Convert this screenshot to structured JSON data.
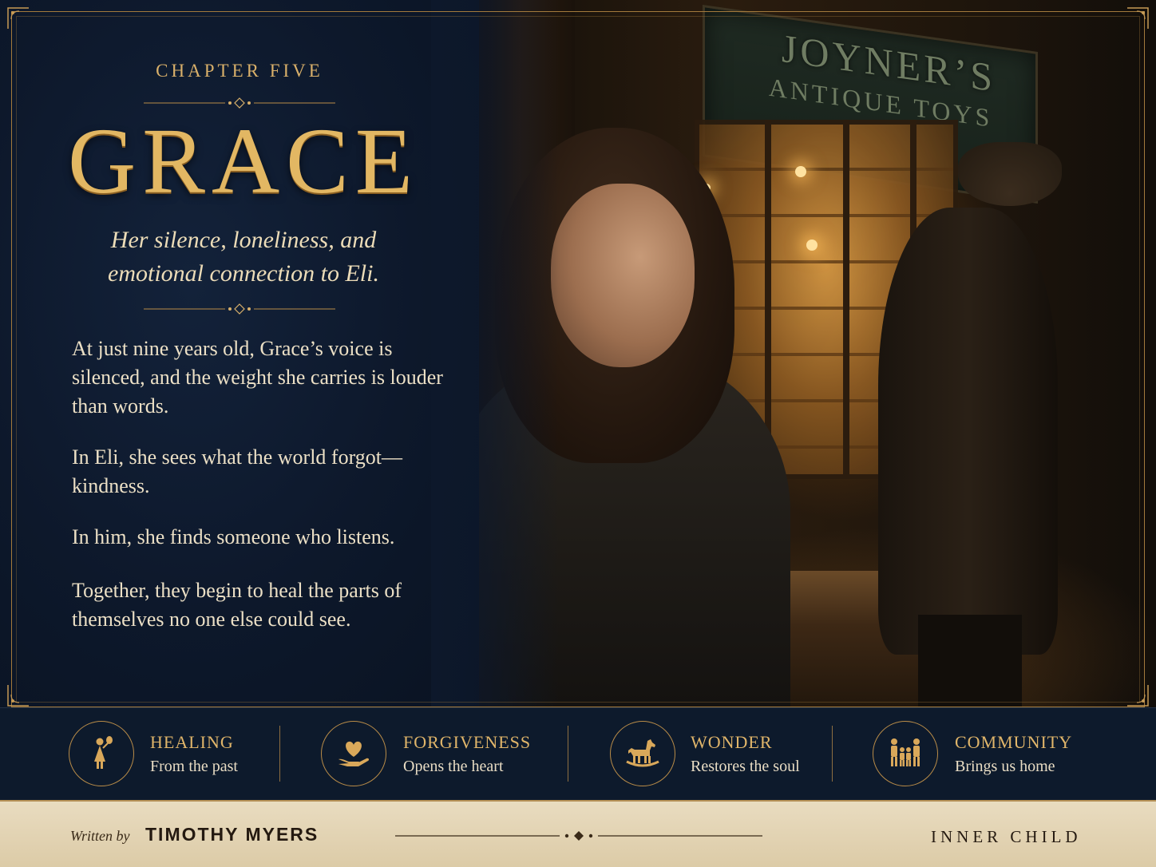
{
  "chapter": {
    "label": "CHAPTER FIVE",
    "title": "GRACE",
    "subtitle": "Her silence, loneliness, and emotional connection to Eli.",
    "paragraphs": [
      "At just nine years old, Grace’s voice is silenced, and the weight she carries is louder than words.",
      "In Eli, she sees what the world forgot—kindness.",
      "In him, she finds someone who listens.",
      "Together, they begin to heal the parts of themselves no one else could see."
    ]
  },
  "scene": {
    "sign_line1": "JOYNER’S",
    "sign_line2": "ANTIQUE TOYS"
  },
  "values": [
    {
      "title": "HEALING",
      "subtitle": "From the past",
      "icon": "girl-balloon-icon"
    },
    {
      "title": "FORGIVENESS",
      "subtitle": "Opens the heart",
      "icon": "heart-hand-icon"
    },
    {
      "title": "WONDER",
      "subtitle": "Restores the soul",
      "icon": "rocking-horse-icon"
    },
    {
      "title": "COMMUNITY",
      "subtitle": "Brings us home",
      "icon": "family-icon"
    }
  ],
  "footer": {
    "written_by": "Written by",
    "author": "TIMOTHY MYERS",
    "series": "INNER CHILD"
  },
  "colors": {
    "navy": "#0d1a2c",
    "gold": "#e2b763",
    "parchment": "#e9dcc0"
  }
}
